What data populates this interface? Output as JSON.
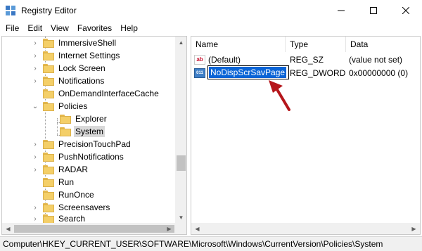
{
  "window": {
    "title": "Registry Editor"
  },
  "menu": [
    "File",
    "Edit",
    "View",
    "Favorites",
    "Help"
  ],
  "tree": {
    "items": [
      {
        "label": "ImmersiveShell",
        "expander": "collapsed"
      },
      {
        "label": "Internet Settings",
        "expander": "collapsed"
      },
      {
        "label": "Lock Screen",
        "expander": "collapsed"
      },
      {
        "label": "Notifications",
        "expander": "collapsed"
      },
      {
        "label": "OnDemandInterfaceCache",
        "expander": "none"
      },
      {
        "label": "Policies",
        "expander": "expanded"
      },
      {
        "label": "Explorer",
        "expander": "none"
      },
      {
        "label": "System",
        "expander": "none",
        "selected": true
      },
      {
        "label": "PrecisionTouchPad",
        "expander": "collapsed"
      },
      {
        "label": "PushNotifications",
        "expander": "collapsed"
      },
      {
        "label": "RADAR",
        "expander": "collapsed"
      },
      {
        "label": "Run",
        "expander": "none"
      },
      {
        "label": "RunOnce",
        "expander": "none"
      },
      {
        "label": "Screensavers",
        "expander": "collapsed"
      },
      {
        "label": "Search",
        "expander": "collapsed"
      }
    ]
  },
  "list": {
    "columns": {
      "name": "Name",
      "type": "Type",
      "data": "Data"
    },
    "rows": [
      {
        "name": "(Default)",
        "type": "REG_SZ",
        "data": "(value not set)",
        "icon": "ab-string-icon"
      },
      {
        "name": "NoDispScrSavPage",
        "type": "REG_DWORD",
        "data": "0x00000000 (0)",
        "icon": "binary-value-icon",
        "editing": true
      }
    ]
  },
  "status": {
    "path": "Computer\\HKEY_CURRENT_USER\\SOFTWARE\\Microsoft\\Windows\\CurrentVersion\\Policies\\System"
  },
  "colors": {
    "accent": "#0a64d6",
    "arrow": "#b5161b",
    "folder": "#f4cf68"
  }
}
